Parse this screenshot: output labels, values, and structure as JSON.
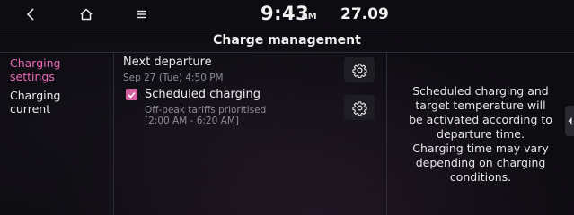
{
  "status_bar": {
    "time": "9:43",
    "ampm": "AM",
    "date": "27.09",
    "icons": [
      "back-icon",
      "home-icon",
      "menu-icon"
    ]
  },
  "header": {
    "title": "Charge management"
  },
  "sidebar": {
    "items": [
      {
        "label_line1": "Charging",
        "label_line2": "settings",
        "active": true
      },
      {
        "label_line1": "Charging",
        "label_line2": "current",
        "active": false
      }
    ]
  },
  "main": {
    "next_departure": {
      "title": "Next departure",
      "subtitle": "Sep 27 (Tue) 4:50 PM"
    },
    "scheduled_charging": {
      "title": "Scheduled charging",
      "checked": true,
      "sub_line1": "Off-peak tariffs prioritised",
      "sub_line2": "[2:00 AM - 6:20 AM]"
    }
  },
  "help": {
    "lines": [
      "Scheduled charging and",
      "target temperature will",
      "be activated according to",
      "departure time.",
      "Charging time may vary",
      "depending on charging",
      "conditions."
    ]
  },
  "colors": {
    "accent": "#e86ab6",
    "checkbox": "#d4609f",
    "background": "#0d0c11"
  }
}
